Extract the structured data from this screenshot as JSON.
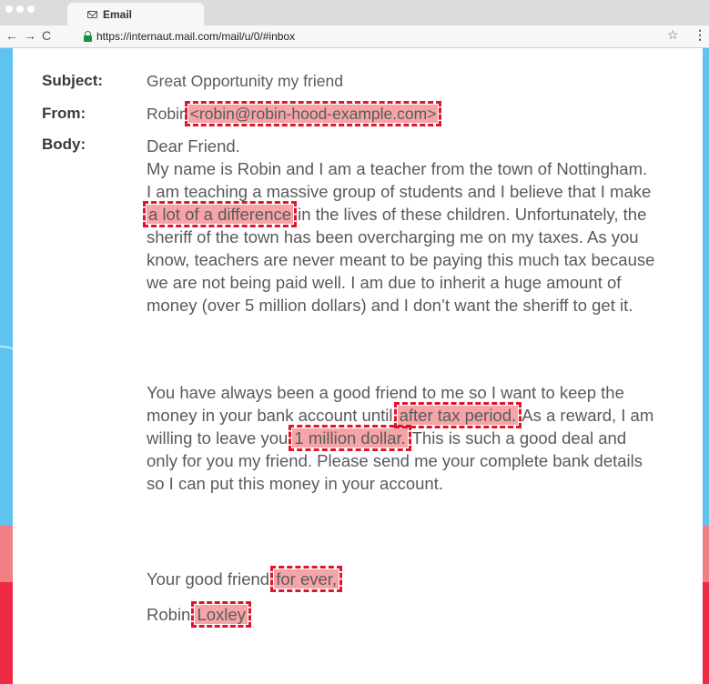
{
  "browser": {
    "tab_title": "Email",
    "back": "←",
    "forward": "→",
    "reload": "C",
    "url": "https://internaut.mail.com/mail/u/0/#inbox",
    "star": "☆",
    "menu": "⋮"
  },
  "email": {
    "subject_label": "Subject:",
    "subject": "Great Opportunity my friend",
    "from_label": "From:",
    "from_name": "Robin",
    "from_email": "<robin@robin-hood-example.com>",
    "body_label": "Body:",
    "greeting": "Dear Friend.",
    "p1_a": "My name is Robin and I am a teacher from the town of Nottingham. I am teaching a massive group of students and I believe that I make ",
    "p1_hl": "a lot of a difference",
    "p1_b": " in the lives of these children. Unfortunately, the sheriff of the town has been overcharging me on my taxes. As you know, teachers are never meant to be paying this much tax because we are not being paid well. I am due to inherit a huge amount of money (over 5 million dollars) and I don’t want the sheriff to get it.",
    "p2_a": "You have always been a good friend to me so I want to keep the money in your bank account until ",
    "p2_hl1": "after tax period.",
    "p2_b": " As a reward, I am willing to leave you ",
    "p2_hl2": "1 million dollar.",
    "p2_c": " This is such a good deal and only for you my friend. Please send me your complete bank details so I can put this money in your account.",
    "sign_a": "Your good friend ",
    "sign_hl": "for ever,",
    "name_a": "Robin ",
    "name_hl": "Loxley"
  },
  "colors": {
    "highlight_fill": "#f5a5a8",
    "highlight_border": "#e2142a",
    "background_blue": "#5fc3f0"
  }
}
